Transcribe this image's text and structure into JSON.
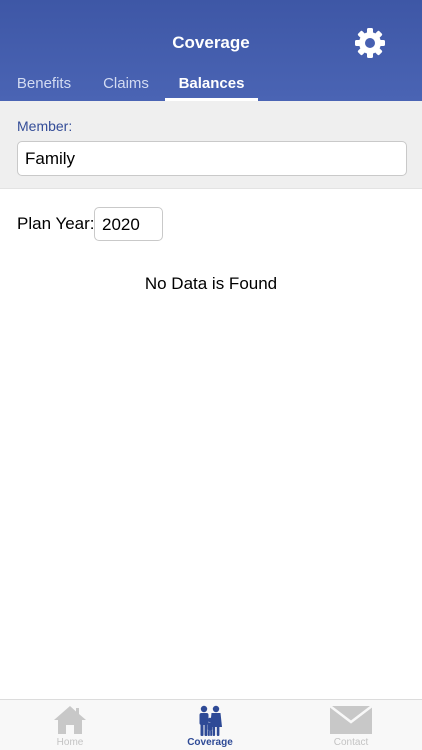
{
  "header": {
    "title": "Coverage",
    "settings_icon": "gear-icon"
  },
  "tabs": [
    {
      "label": "Benefits",
      "active": false
    },
    {
      "label": "Claims",
      "active": false
    },
    {
      "label": "Balances",
      "active": true
    }
  ],
  "member": {
    "label": "Member:",
    "value": "Family"
  },
  "plan_year": {
    "label": "Plan Year:",
    "value": "2020"
  },
  "empty_message": "No Data is Found",
  "tabbar": {
    "items": [
      {
        "label": "Home",
        "icon": "home-icon",
        "active": false
      },
      {
        "label": "Coverage",
        "icon": "family-icon",
        "active": true
      },
      {
        "label": "Contact",
        "icon": "envelope-icon",
        "active": false
      }
    ]
  },
  "colors": {
    "header": "#4a64b4",
    "accent": "#2e4a96",
    "inactive": "#c3c3c3"
  }
}
